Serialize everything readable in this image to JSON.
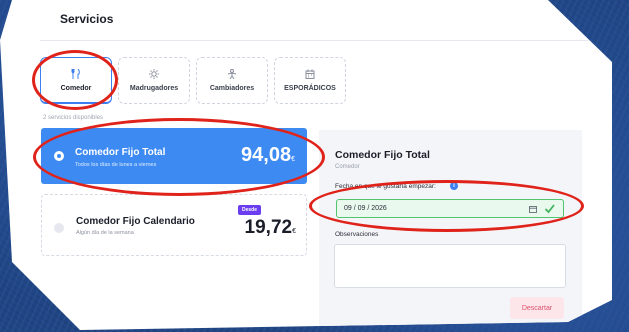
{
  "header": {
    "title": "Servicios"
  },
  "tabs": [
    {
      "label": "Comedor",
      "icon": "fork-knife-icon",
      "active": true
    },
    {
      "label": "Madrugadores",
      "icon": "sun-gear-icon",
      "active": false
    },
    {
      "label": "Cambiadores",
      "icon": "baby-icon",
      "active": false
    },
    {
      "label": "ESPORÁDICOS",
      "icon": "calendar-icon",
      "active": false
    }
  ],
  "services_count": "2 servicios disponibles",
  "services": [
    {
      "name": "Comedor Fijo Total",
      "subtitle": "Todos los días de lunes a viernes",
      "price": "94,08",
      "currency": "€",
      "selected": true
    },
    {
      "name": "Comedor Fijo Calendario",
      "subtitle": "Algún día de la semana",
      "badge": "Desde",
      "price": "19,72",
      "currency": "€",
      "selected": false
    }
  ],
  "detail": {
    "title": "Comedor Fijo Total",
    "subtitle": "Comedor",
    "date_label": "Fecha en que le gustaría empezar:",
    "date_value": "09 / 09 / 2026",
    "observations_label": "Observaciones",
    "discard_label": "Descartar"
  },
  "colors": {
    "accent": "#3d8bf2",
    "valid": "#52c46e",
    "annotation": "#e0231a",
    "badge": "#6a3df0"
  }
}
